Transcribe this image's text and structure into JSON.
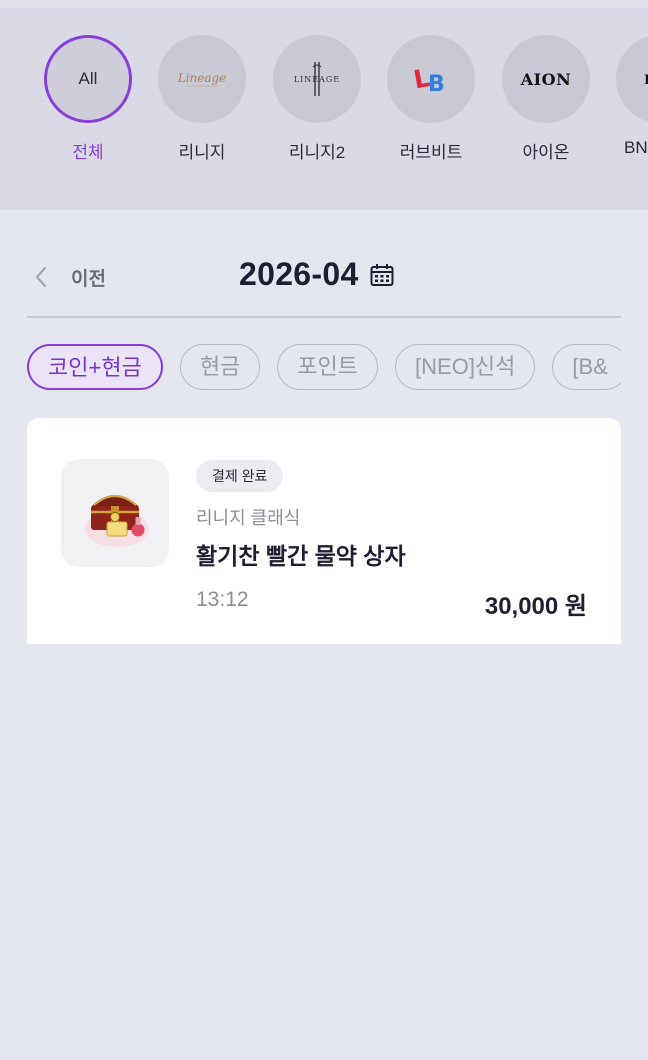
{
  "games": [
    {
      "label": "전체",
      "circle_text": "All",
      "active": true,
      "icon": "all-text"
    },
    {
      "label": "리니지",
      "circle_text": "",
      "icon": "lineage-logo"
    },
    {
      "label": "리니지2",
      "circle_text": "",
      "icon": "lineage2-logo"
    },
    {
      "label": "러브비트",
      "circle_text": "",
      "icon": "lovebeat-logo"
    },
    {
      "label": "아이온",
      "circle_text": "",
      "icon": "aion-logo"
    },
    {
      "label": "BN",
      "circle_text": "",
      "icon": "bns-logo"
    }
  ],
  "nav": {
    "prev_label": "이전",
    "month": "2026-04"
  },
  "filters": [
    "코인+현금",
    "현금",
    "포인트",
    "[NEO]신석",
    "[B&"
  ],
  "transaction": {
    "status": "결제 완료",
    "game": "리니지 클래식",
    "item": "활기찬 빨간 물약 상자",
    "time": "13:12",
    "amount": "30,000 원"
  },
  "colors": {
    "accent": "#8a3fd9",
    "background": "#e5e7f0",
    "game_bar": "#d9dae6"
  }
}
